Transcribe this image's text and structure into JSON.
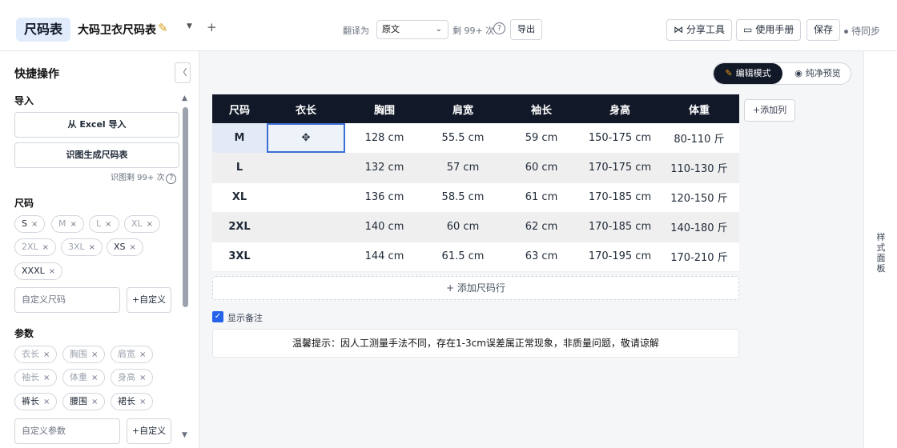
{
  "header": {
    "brand": "尺码表",
    "doc_title": "大码卫衣尺码表",
    "translate_label": "翻译为",
    "language": "原文",
    "remaining": "剩 99+ 次",
    "help": "?",
    "export": "导出",
    "share": "分享工具",
    "manual": "使用手册",
    "save": "保存",
    "sync": "待同步"
  },
  "sidebar": {
    "title": "快捷操作",
    "collapse": "〈",
    "import_label": "导入",
    "excel_import": "从 Excel 导入",
    "ocr_generate": "识图生成尺码表",
    "ocr_remaining": "识图剩 99+ 次",
    "sizes_label": "尺码",
    "sizes": [
      {
        "label": "S",
        "active": true
      },
      {
        "label": "M",
        "active": false
      },
      {
        "label": "L",
        "active": false
      },
      {
        "label": "XL",
        "active": false
      },
      {
        "label": "2XL",
        "active": false
      },
      {
        "label": "3XL",
        "active": false
      },
      {
        "label": "XS",
        "active": true
      },
      {
        "label": "XXXL",
        "active": true
      }
    ],
    "custom_size_placeholder": "自定义尺码",
    "custom_add": "+自定义",
    "params_label": "参数",
    "params": [
      {
        "label": "衣长",
        "active": false
      },
      {
        "label": "胸围",
        "active": false
      },
      {
        "label": "肩宽",
        "active": false
      },
      {
        "label": "袖长",
        "active": false
      },
      {
        "label": "体重",
        "active": false
      },
      {
        "label": "身高",
        "active": false
      },
      {
        "label": "裤长",
        "active": true
      },
      {
        "label": "腰围",
        "active": true
      },
      {
        "label": "裙长",
        "active": true
      }
    ],
    "custom_param_placeholder": "自定义参数"
  },
  "main": {
    "mode_edit": "编辑模式",
    "mode_preview": "纯净预览",
    "add_col": "+添加列",
    "table": {
      "headers": [
        "尺码",
        "衣长",
        "胸围",
        "肩宽",
        "袖长",
        "身高",
        "体重"
      ],
      "rows": [
        [
          "M",
          "",
          "128 cm",
          "55.5 cm",
          "59 cm",
          "150-175 cm",
          "80-110 斤"
        ],
        [
          "L",
          "",
          "132 cm",
          "57 cm",
          "60 cm",
          "170-175 cm",
          "110-130 斤"
        ],
        [
          "XL",
          "",
          "136 cm",
          "58.5 cm",
          "61 cm",
          "170-185 cm",
          "120-150 斤"
        ],
        [
          "2XL",
          "",
          "140 cm",
          "60 cm",
          "62 cm",
          "170-185 cm",
          "140-180 斤"
        ],
        [
          "3XL",
          "",
          "144 cm",
          "61.5 cm",
          "63 cm",
          "170-195 cm",
          "170-210 斤"
        ]
      ]
    },
    "add_row": "+ 添加尺码行",
    "show_note": "显示备注",
    "note": "温馨提示：因人工测量手法不同，存在1-3cm误差属正常现象，非质量问题，敬请谅解"
  },
  "right_panel": {
    "label": "样式面板"
  }
}
